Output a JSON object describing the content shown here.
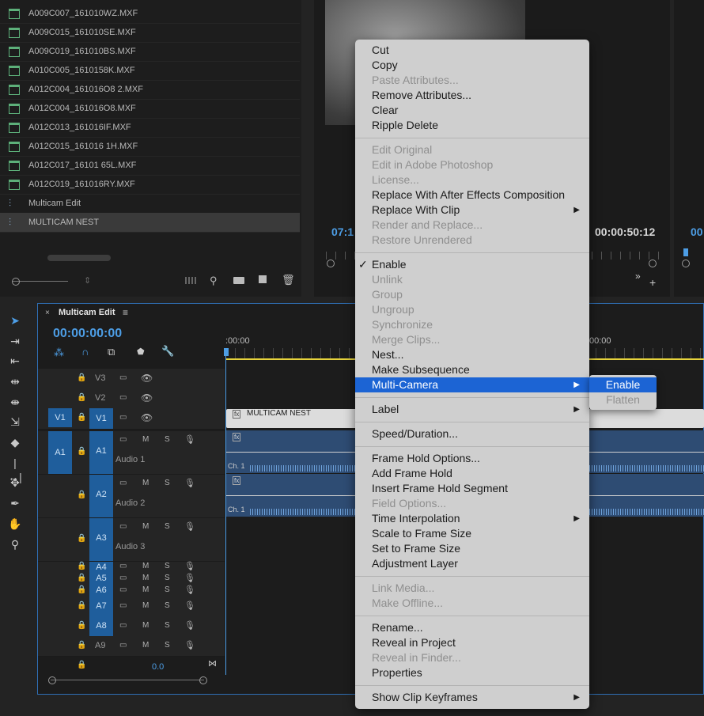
{
  "project": {
    "items": [
      {
        "name": "A009C007_161010WZ.MXF",
        "type": "clip"
      },
      {
        "name": "A009C015_161010SE.MXF",
        "type": "clip"
      },
      {
        "name": "A009C019_161010BS.MXF",
        "type": "clip"
      },
      {
        "name": "A010C005_1610158K.MXF",
        "type": "clip"
      },
      {
        "name": "A012C004_161016O8 2.MXF",
        "type": "clip"
      },
      {
        "name": "A012C004_161016O8.MXF",
        "type": "clip"
      },
      {
        "name": "A012C013_161016IF.MXF",
        "type": "clip"
      },
      {
        "name": "A012C015_161016 1H.MXF",
        "type": "clip"
      },
      {
        "name": "A012C017_16101 65L.MXF",
        "type": "clip"
      },
      {
        "name": "A012C019_161016RY.MXF",
        "type": "clip"
      },
      {
        "name": "Multicam Edit",
        "type": "sequence"
      },
      {
        "name": "MULTICAM NEST",
        "type": "sequence"
      }
    ]
  },
  "source_monitor": {
    "timecode_left": "07:1",
    "timecode_right": "00:00:50:12"
  },
  "program_monitor": {
    "timecode": "00"
  },
  "timeline": {
    "tab_label": "Multicam Edit",
    "timecode": "00:00:00:00",
    "ruler_start": ":00:00",
    "ruler_mid": "00:00",
    "clip_name": "MULTICAM NEST",
    "channel_label": "Ch. 1",
    "master_volume": "0.0",
    "tracks": {
      "v3": "V3",
      "v2": "V2",
      "v1": "V1",
      "v1_source": "V1",
      "a1": "A1",
      "a1_source": "A1",
      "a2": "A2",
      "a3": "A3",
      "a4": "A4",
      "a5": "A5",
      "a6": "A6",
      "a7": "A7",
      "a8": "A8",
      "a9": "A9",
      "audio1": "Audio 1",
      "audio2": "Audio 2",
      "audio3": "Audio 3",
      "mute": "M",
      "solo": "S"
    }
  },
  "menu": {
    "cut": "Cut",
    "copy": "Copy",
    "paste_attributes": "Paste Attributes...",
    "remove_attributes": "Remove Attributes...",
    "clear": "Clear",
    "ripple_delete": "Ripple Delete",
    "edit_original": "Edit Original",
    "edit_photoshop": "Edit in Adobe Photoshop",
    "license": "License...",
    "replace_ae": "Replace With After Effects Composition",
    "replace_clip": "Replace With Clip",
    "render_replace": "Render and Replace...",
    "restore_unrendered": "Restore Unrendered",
    "enable": "Enable",
    "unlink": "Unlink",
    "group": "Group",
    "ungroup": "Ungroup",
    "synchronize": "Synchronize",
    "merge_clips": "Merge Clips...",
    "nest": "Nest...",
    "make_subsequence": "Make Subsequence",
    "multi_camera": "Multi-Camera",
    "label": "Label",
    "speed_duration": "Speed/Duration...",
    "frame_hold_options": "Frame Hold Options...",
    "add_frame_hold": "Add Frame Hold",
    "insert_frame_hold": "Insert Frame Hold Segment",
    "field_options": "Field Options...",
    "time_interpolation": "Time Interpolation",
    "scale_frame": "Scale to Frame Size",
    "set_frame": "Set to Frame Size",
    "adjustment_layer": "Adjustment Layer",
    "link_media": "Link Media...",
    "make_offline": "Make Offline...",
    "rename": "Rename...",
    "reveal_project": "Reveal in Project",
    "reveal_finder": "Reveal in Finder...",
    "properties": "Properties",
    "show_keyframes": "Show Clip Keyframes"
  },
  "submenu": {
    "enable": "Enable",
    "flatten": "Flatten"
  },
  "colors": {
    "accent_blue": "#1c64d4",
    "timecode_blue": "#4d9ee6",
    "playhead_yellow": "#e6d33c",
    "track_target_blue": "#1f5e9c"
  }
}
